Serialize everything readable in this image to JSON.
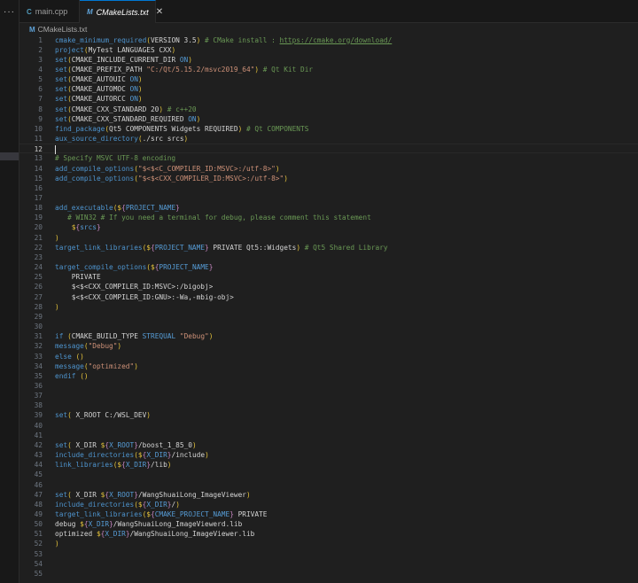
{
  "tabs": [
    {
      "label": "main.cpp",
      "icon": "C",
      "active": false
    },
    {
      "label": "CMakeLists.txt",
      "icon": "M",
      "active": true
    }
  ],
  "more_label": "···",
  "close_glyph": "✕",
  "breadcrumb": {
    "icon": "M",
    "label": "CMakeLists.txt"
  },
  "current_line": 12,
  "lines": [
    [
      [
        "f",
        "cmake_minimum_required"
      ],
      [
        "p",
        "("
      ],
      [
        "t",
        "VERSION 3.5"
      ],
      [
        "p",
        ")"
      ],
      [
        "c",
        " # CMake install : "
      ],
      [
        "u",
        "https://cmake.org/download/"
      ]
    ],
    [
      [
        "f",
        "project"
      ],
      [
        "p",
        "("
      ],
      [
        "t",
        "MyTest LANGUAGES CXX"
      ],
      [
        "p",
        ")"
      ]
    ],
    [
      [
        "f",
        "set"
      ],
      [
        "p",
        "("
      ],
      [
        "t",
        "CMAKE_INCLUDE_CURRENT_DIR "
      ],
      [
        "k",
        "ON"
      ],
      [
        "p",
        ")"
      ]
    ],
    [
      [
        "f",
        "set"
      ],
      [
        "p",
        "("
      ],
      [
        "t",
        "CMAKE_PREFIX_PATH "
      ],
      [
        "s",
        "\"C:/Qt/5.15.2/msvc2019_64\""
      ],
      [
        "p",
        ")"
      ],
      [
        "c",
        " # Qt Kit Dir"
      ]
    ],
    [
      [
        "f",
        "set"
      ],
      [
        "p",
        "("
      ],
      [
        "t",
        "CMAKE_AUTOUIC "
      ],
      [
        "k",
        "ON"
      ],
      [
        "p",
        ")"
      ]
    ],
    [
      [
        "f",
        "set"
      ],
      [
        "p",
        "("
      ],
      [
        "t",
        "CMAKE_AUTOMOC "
      ],
      [
        "k",
        "ON"
      ],
      [
        "p",
        ")"
      ]
    ],
    [
      [
        "f",
        "set"
      ],
      [
        "p",
        "("
      ],
      [
        "t",
        "CMAKE_AUTORCC "
      ],
      [
        "k",
        "ON"
      ],
      [
        "p",
        ")"
      ]
    ],
    [
      [
        "f",
        "set"
      ],
      [
        "p",
        "("
      ],
      [
        "t",
        "CMAKE_CXX_STANDARD 20"
      ],
      [
        "p",
        ")"
      ],
      [
        "c",
        " # c++20"
      ]
    ],
    [
      [
        "f",
        "set"
      ],
      [
        "p",
        "("
      ],
      [
        "t",
        "CMAKE_CXX_STANDARD_REQUIRED "
      ],
      [
        "k",
        "ON"
      ],
      [
        "p",
        ")"
      ]
    ],
    [
      [
        "f",
        "find_package"
      ],
      [
        "p",
        "("
      ],
      [
        "t",
        "Qt5 COMPONENTS Widgets REQUIRED"
      ],
      [
        "p",
        ")"
      ],
      [
        "c",
        " # Qt COMPONENTS"
      ]
    ],
    [
      [
        "f",
        "aux_source_directory"
      ],
      [
        "p",
        "("
      ],
      [
        "t",
        "./src srcs"
      ],
      [
        "p",
        ")"
      ]
    ],
    [],
    [
      [
        "c",
        "# Specify MSVC UTF-8 encoding"
      ]
    ],
    [
      [
        "f",
        "add_compile_options"
      ],
      [
        "p",
        "("
      ],
      [
        "s",
        "\"$<$<C_COMPILER_ID:MSVC>:/utf-8>\""
      ],
      [
        "p",
        ")"
      ]
    ],
    [
      [
        "f",
        "add_compile_options"
      ],
      [
        "p",
        "("
      ],
      [
        "s",
        "\"$<$<CXX_COMPILER_ID:MSVC>:/utf-8>\""
      ],
      [
        "p",
        ")"
      ]
    ],
    [],
    [],
    [
      [
        "f",
        "add_executable"
      ],
      [
        "p",
        "("
      ],
      [
        "d",
        "$"
      ],
      [
        "b",
        "{"
      ],
      [
        "v",
        "PROJECT_NAME"
      ],
      [
        "b",
        "}"
      ]
    ],
    [
      [
        "t",
        "   "
      ],
      [
        "c",
        "# WIN32 # If you need a terminal for debug, please comment this statement"
      ]
    ],
    [
      [
        "t",
        "    "
      ],
      [
        "d",
        "$"
      ],
      [
        "b",
        "{"
      ],
      [
        "v",
        "srcs"
      ],
      [
        "b",
        "}"
      ]
    ],
    [
      [
        "p",
        ")"
      ]
    ],
    [
      [
        "f",
        "target_link_libraries"
      ],
      [
        "p",
        "("
      ],
      [
        "d",
        "$"
      ],
      [
        "b",
        "{"
      ],
      [
        "v",
        "PROJECT_NAME"
      ],
      [
        "b",
        "}"
      ],
      [
        "t",
        " PRIVATE Qt5::Widgets"
      ],
      [
        "p",
        ")"
      ],
      [
        "c",
        " # Qt5 Shared Library"
      ]
    ],
    [],
    [
      [
        "f",
        "target_compile_options"
      ],
      [
        "p",
        "("
      ],
      [
        "d",
        "$"
      ],
      [
        "b",
        "{"
      ],
      [
        "v",
        "PROJECT_NAME"
      ],
      [
        "b",
        "}"
      ]
    ],
    [
      [
        "t",
        "    PRIVATE"
      ]
    ],
    [
      [
        "t",
        "    $<$<CXX_COMPILER_ID:MSVC>:/bigobj>"
      ]
    ],
    [
      [
        "t",
        "    $<$<CXX_COMPILER_ID:GNU>:-Wa,-mbig-obj>"
      ]
    ],
    [
      [
        "p",
        ")"
      ]
    ],
    [],
    [],
    [
      [
        "f",
        "if"
      ],
      [
        "t",
        " "
      ],
      [
        "p",
        "("
      ],
      [
        "t",
        "CMAKE_BUILD_TYPE "
      ],
      [
        "k",
        "STREQUAL"
      ],
      [
        "t",
        " "
      ],
      [
        "s",
        "\"Debug\""
      ],
      [
        "p",
        ")"
      ]
    ],
    [
      [
        "f",
        "message"
      ],
      [
        "p",
        "("
      ],
      [
        "s",
        "\"Debug\""
      ],
      [
        "p",
        ")"
      ]
    ],
    [
      [
        "f",
        "else"
      ],
      [
        "t",
        " "
      ],
      [
        "p",
        "()"
      ]
    ],
    [
      [
        "f",
        "message"
      ],
      [
        "p",
        "("
      ],
      [
        "s",
        "\"optimized\""
      ],
      [
        "p",
        ")"
      ]
    ],
    [
      [
        "f",
        "endif"
      ],
      [
        "t",
        " "
      ],
      [
        "p",
        "()"
      ]
    ],
    [],
    [],
    [],
    [
      [
        "f",
        "set"
      ],
      [
        "p",
        "("
      ],
      [
        "t",
        " X_ROOT C:/WSL_DEV"
      ],
      [
        "p",
        ")"
      ]
    ],
    [],
    [],
    [
      [
        "f",
        "set"
      ],
      [
        "p",
        "("
      ],
      [
        "t",
        " X_DIR "
      ],
      [
        "d",
        "$"
      ],
      [
        "b",
        "{"
      ],
      [
        "v",
        "X_ROOT"
      ],
      [
        "b",
        "}"
      ],
      [
        "t",
        "/boost_1_85_0"
      ],
      [
        "p",
        ")"
      ]
    ],
    [
      [
        "f",
        "include_directories"
      ],
      [
        "p",
        "("
      ],
      [
        "d",
        "$"
      ],
      [
        "b",
        "{"
      ],
      [
        "v",
        "X_DIR"
      ],
      [
        "b",
        "}"
      ],
      [
        "t",
        "/include"
      ],
      [
        "p",
        ")"
      ]
    ],
    [
      [
        "f",
        "link_libraries"
      ],
      [
        "p",
        "("
      ],
      [
        "d",
        "$"
      ],
      [
        "b",
        "{"
      ],
      [
        "v",
        "X_DIR"
      ],
      [
        "b",
        "}"
      ],
      [
        "t",
        "/lib"
      ],
      [
        "p",
        ")"
      ]
    ],
    [],
    [],
    [
      [
        "f",
        "set"
      ],
      [
        "p",
        "("
      ],
      [
        "t",
        " X_DIR "
      ],
      [
        "d",
        "$"
      ],
      [
        "b",
        "{"
      ],
      [
        "v",
        "X_ROOT"
      ],
      [
        "b",
        "}"
      ],
      [
        "t",
        "/WangShuaiLong_ImageViewer"
      ],
      [
        "p",
        ")"
      ]
    ],
    [
      [
        "f",
        "include_directories"
      ],
      [
        "p",
        "("
      ],
      [
        "d",
        "$"
      ],
      [
        "b",
        "{"
      ],
      [
        "v",
        "X_DIR"
      ],
      [
        "b",
        "}"
      ],
      [
        "t",
        "/"
      ],
      [
        "p",
        ")"
      ]
    ],
    [
      [
        "f",
        "target_link_libraries"
      ],
      [
        "p",
        "("
      ],
      [
        "d",
        "$"
      ],
      [
        "b",
        "{"
      ],
      [
        "v",
        "CMAKE_PROJECT_NAME"
      ],
      [
        "b",
        "}"
      ],
      [
        "t",
        " PRIVATE"
      ]
    ],
    [
      [
        "t",
        "debug "
      ],
      [
        "d",
        "$"
      ],
      [
        "b",
        "{"
      ],
      [
        "v",
        "X_DIR"
      ],
      [
        "b",
        "}"
      ],
      [
        "t",
        "/WangShuaiLong_ImageViewerd.lib"
      ]
    ],
    [
      [
        "t",
        "optimized "
      ],
      [
        "d",
        "$"
      ],
      [
        "b",
        "{"
      ],
      [
        "v",
        "X_DIR"
      ],
      [
        "b",
        "}"
      ],
      [
        "t",
        "/WangShuaiLong_ImageViewer.lib"
      ]
    ],
    [
      [
        "p",
        ")"
      ]
    ],
    [],
    [],
    []
  ]
}
